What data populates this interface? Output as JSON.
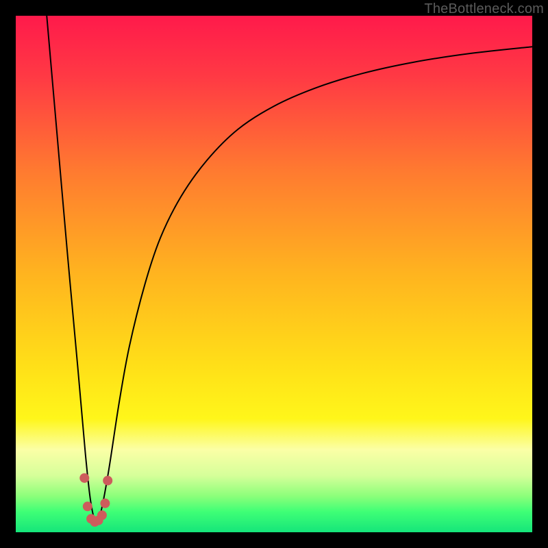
{
  "watermark": "TheBottleneck.com",
  "chart_data": {
    "type": "line",
    "title": "",
    "xlabel": "",
    "ylabel": "",
    "xlim": [
      0,
      100
    ],
    "ylim": [
      0,
      100
    ],
    "grid": false,
    "gradient_stops": [
      {
        "offset": 0.0,
        "color": "#ff1a4b"
      },
      {
        "offset": 0.12,
        "color": "#ff3a44"
      },
      {
        "offset": 0.3,
        "color": "#ff7a30"
      },
      {
        "offset": 0.5,
        "color": "#ffb41f"
      },
      {
        "offset": 0.68,
        "color": "#ffe018"
      },
      {
        "offset": 0.78,
        "color": "#fff61a"
      },
      {
        "offset": 0.84,
        "color": "#fbffa6"
      },
      {
        "offset": 0.89,
        "color": "#d6ff9a"
      },
      {
        "offset": 0.93,
        "color": "#8cff7a"
      },
      {
        "offset": 0.96,
        "color": "#3fff76"
      },
      {
        "offset": 1.0,
        "color": "#15e57a"
      }
    ],
    "series": [
      {
        "name": "bottleneck-curve",
        "stroke": "#000000",
        "stroke_width": 2,
        "x": [
          6,
          8,
          10,
          12,
          13.5,
          14.5,
          15.5,
          16.5,
          18,
          20,
          22,
          25,
          28,
          32,
          37,
          43,
          50,
          58,
          67,
          77,
          88,
          100
        ],
        "y": [
          100,
          77,
          54,
          32,
          15,
          6,
          2,
          4,
          12,
          25,
          36,
          48,
          57,
          65,
          72,
          78,
          82.5,
          86,
          88.8,
          91,
          92.7,
          94
        ]
      },
      {
        "name": "highlight-dots",
        "type": "scatter",
        "stroke": "#cd5c5c",
        "fill": "#cd5c5c",
        "marker_radius_px": 7,
        "x": [
          13.3,
          13.9,
          14.6,
          15.3,
          16.0,
          16.7,
          17.3,
          17.8
        ],
        "y": [
          10.5,
          5.0,
          2.6,
          2.0,
          2.3,
          3.3,
          5.6,
          10.0
        ]
      }
    ]
  }
}
